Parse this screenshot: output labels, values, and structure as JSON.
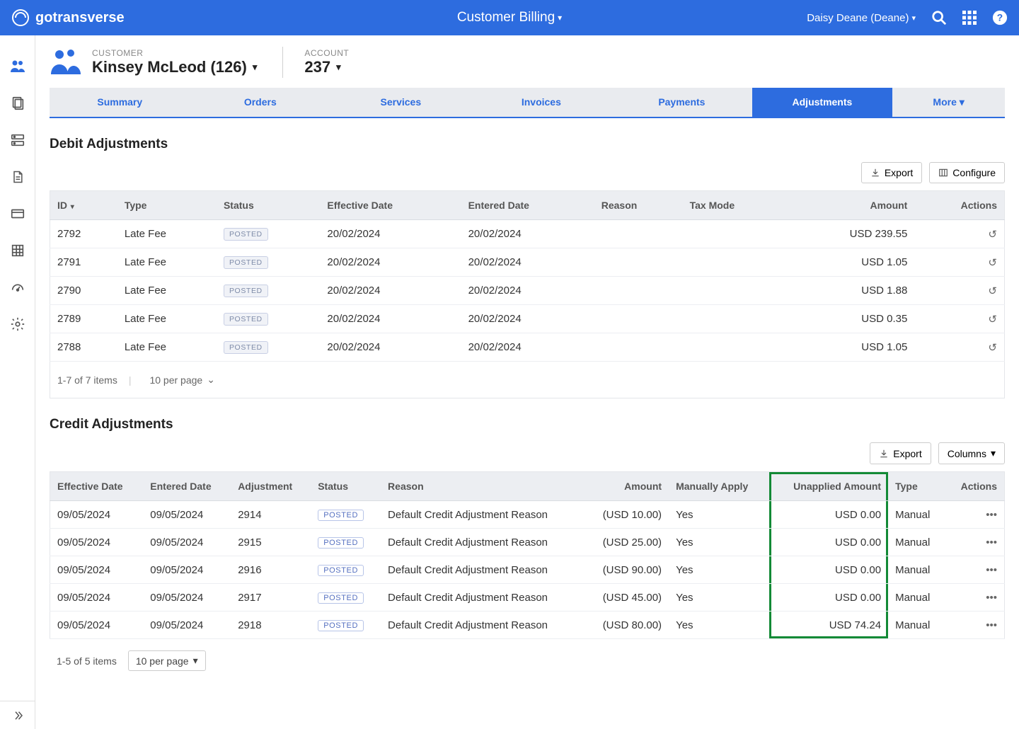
{
  "topbar": {
    "brand": "gotransverse",
    "title": "Customer Billing",
    "user": "Daisy Deane (Deane)"
  },
  "customer": {
    "label": "CUSTOMER",
    "name": "Kinsey McLeod (126)"
  },
  "account": {
    "label": "ACCOUNT",
    "value": "237"
  },
  "tabs": {
    "summary": "Summary",
    "orders": "Orders",
    "services": "Services",
    "invoices": "Invoices",
    "payments": "Payments",
    "adjustments": "Adjustments",
    "more": "More"
  },
  "debit": {
    "title": "Debit Adjustments",
    "export": "Export",
    "configure": "Configure",
    "columns": {
      "id": "ID",
      "type": "Type",
      "status": "Status",
      "effective": "Effective Date",
      "entered": "Entered Date",
      "reason": "Reason",
      "taxmode": "Tax Mode",
      "amount": "Amount",
      "actions": "Actions"
    },
    "rows": [
      {
        "id": "2792",
        "type": "Late Fee",
        "status": "POSTED",
        "effective": "20/02/2024",
        "entered": "20/02/2024",
        "amount": "USD 239.55"
      },
      {
        "id": "2791",
        "type": "Late Fee",
        "status": "POSTED",
        "effective": "20/02/2024",
        "entered": "20/02/2024",
        "amount": "USD 1.05"
      },
      {
        "id": "2790",
        "type": "Late Fee",
        "status": "POSTED",
        "effective": "20/02/2024",
        "entered": "20/02/2024",
        "amount": "USD 1.88"
      },
      {
        "id": "2789",
        "type": "Late Fee",
        "status": "POSTED",
        "effective": "20/02/2024",
        "entered": "20/02/2024",
        "amount": "USD 0.35"
      },
      {
        "id": "2788",
        "type": "Late Fee",
        "status": "POSTED",
        "effective": "20/02/2024",
        "entered": "20/02/2024",
        "amount": "USD 1.05"
      }
    ],
    "footer": {
      "count": "1-7 of 7 items",
      "perpage": "10 per page"
    }
  },
  "credit": {
    "title": "Credit Adjustments",
    "export": "Export",
    "columnsBtn": "Columns",
    "columns": {
      "effective": "Effective Date",
      "entered": "Entered Date",
      "adjustment": "Adjustment",
      "status": "Status",
      "reason": "Reason",
      "amount": "Amount",
      "manually": "Manually Apply",
      "unapplied": "Unapplied Amount",
      "type": "Type",
      "actions": "Actions"
    },
    "rows": [
      {
        "effective": "09/05/2024",
        "entered": "09/05/2024",
        "adjustment": "2914",
        "status": "POSTED",
        "reason": "Default Credit Adjustment Reason",
        "amount": "(USD 10.00)",
        "manually": "Yes",
        "unapplied": "USD 0.00",
        "type": "Manual"
      },
      {
        "effective": "09/05/2024",
        "entered": "09/05/2024",
        "adjustment": "2915",
        "status": "POSTED",
        "reason": "Default Credit Adjustment Reason",
        "amount": "(USD 25.00)",
        "manually": "Yes",
        "unapplied": "USD 0.00",
        "type": "Manual"
      },
      {
        "effective": "09/05/2024",
        "entered": "09/05/2024",
        "adjustment": "2916",
        "status": "POSTED",
        "reason": "Default Credit Adjustment Reason",
        "amount": "(USD 90.00)",
        "manually": "Yes",
        "unapplied": "USD 0.00",
        "type": "Manual"
      },
      {
        "effective": "09/05/2024",
        "entered": "09/05/2024",
        "adjustment": "2917",
        "status": "POSTED",
        "reason": "Default Credit Adjustment Reason",
        "amount": "(USD 45.00)",
        "manually": "Yes",
        "unapplied": "USD 0.00",
        "type": "Manual"
      },
      {
        "effective": "09/05/2024",
        "entered": "09/05/2024",
        "adjustment": "2918",
        "status": "POSTED",
        "reason": "Default Credit Adjustment Reason",
        "amount": "(USD 80.00)",
        "manually": "Yes",
        "unapplied": "USD 74.24",
        "type": "Manual"
      }
    ],
    "footer": {
      "count": "1-5 of 5 items",
      "perpage": "10 per page"
    }
  }
}
